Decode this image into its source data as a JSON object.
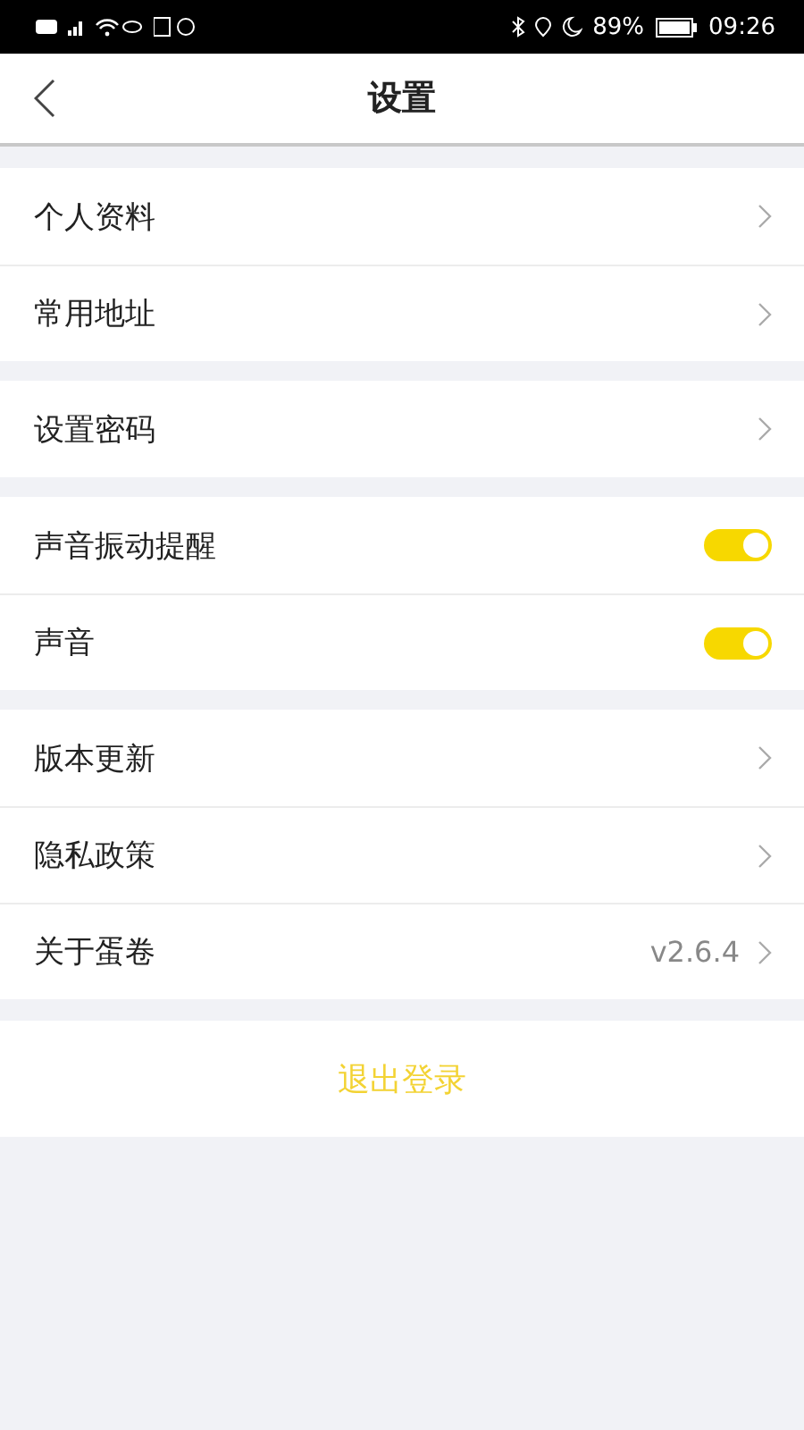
{
  "status_bar": {
    "battery_percent": "89%",
    "time": "09:26"
  },
  "header": {
    "title": "设置"
  },
  "groups": [
    {
      "items": [
        {
          "kind": "link",
          "label": "个人资料"
        },
        {
          "kind": "link",
          "label": "常用地址"
        }
      ]
    },
    {
      "items": [
        {
          "kind": "link",
          "label": "设置密码"
        }
      ]
    },
    {
      "items": [
        {
          "kind": "toggle",
          "label": "声音振动提醒",
          "on": true
        },
        {
          "kind": "toggle",
          "label": "声音",
          "on": true
        }
      ]
    },
    {
      "items": [
        {
          "kind": "link",
          "label": "版本更新"
        },
        {
          "kind": "link",
          "label": "隐私政策"
        },
        {
          "kind": "link",
          "label": "关于蛋卷",
          "value": "v2.6.4"
        }
      ]
    }
  ],
  "logout": {
    "label": "退出登录"
  }
}
